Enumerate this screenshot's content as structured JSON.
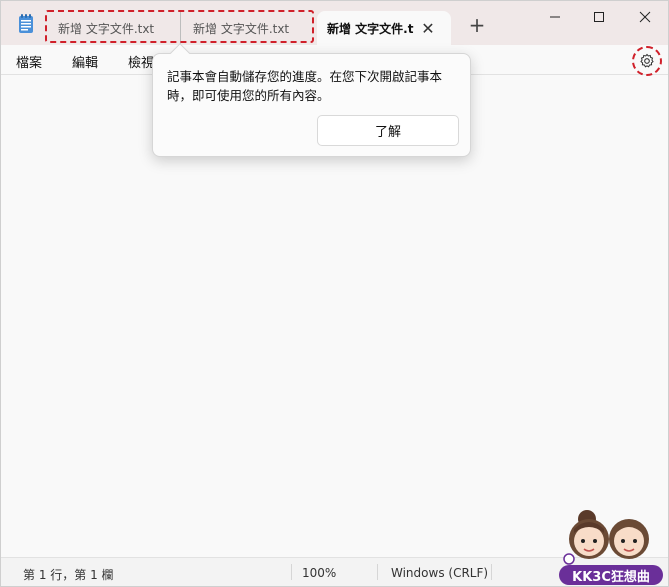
{
  "titlebar": {
    "tabs": [
      {
        "label": "新增 文字文件.txt"
      },
      {
        "label": "新增 文字文件.txt"
      },
      {
        "label": "新增 文字文件.t"
      }
    ],
    "new_tab_label": "+",
    "close_tab_label": "✕"
  },
  "menu": {
    "items": [
      "檔案",
      "編輯",
      "檢視"
    ]
  },
  "popup": {
    "message": "記事本會自動儲存您的進度。在您下次開啟記事本時，即可使用您的所有內容。",
    "button_label": "了解"
  },
  "statusbar": {
    "position": "第 1 行，第 1 欄",
    "zoom": "100%",
    "line_ending": "Windows (CRLF)"
  },
  "watermark": {
    "text": "KK3C狂想曲"
  },
  "colors": {
    "highlight": "#d0202a",
    "titlebar": "#f0e8e8",
    "watermark": "#6a2f99"
  }
}
